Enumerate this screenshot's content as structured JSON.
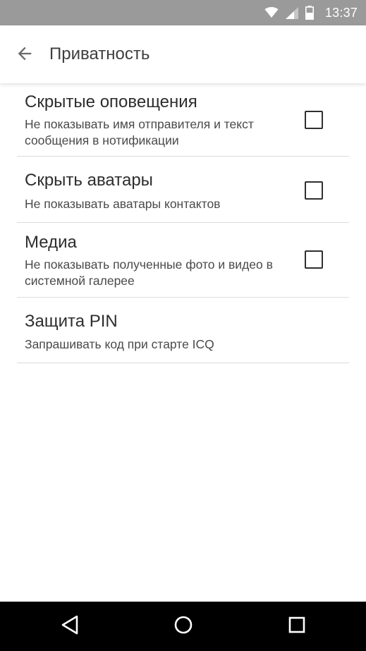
{
  "status_bar": {
    "time": "13:37",
    "icons": [
      "wifi-icon",
      "signal-icon",
      "battery-icon"
    ],
    "background_color": "#9a9a9a"
  },
  "app_bar": {
    "back_icon": "arrow-back-icon",
    "title": "Приватность"
  },
  "settings": [
    {
      "title": "Скрытые оповещения",
      "summary": "Не показывать имя отправителя и текст сообщения в нотификации",
      "has_checkbox": true,
      "checked": false
    },
    {
      "title": "Скрыть аватары",
      "summary": "Не показывать аватары контактов",
      "has_checkbox": true,
      "checked": false
    },
    {
      "title": "Медиа",
      "summary": "Не показывать полученные фото и видео в системной галерее",
      "has_checkbox": true,
      "checked": false
    },
    {
      "title": "Защита PIN",
      "summary": "Запрашивать код при старте ICQ",
      "has_checkbox": false
    }
  ],
  "nav_bar": {
    "buttons": [
      "back-triangle-icon",
      "home-circle-icon",
      "recents-square-icon"
    ]
  }
}
